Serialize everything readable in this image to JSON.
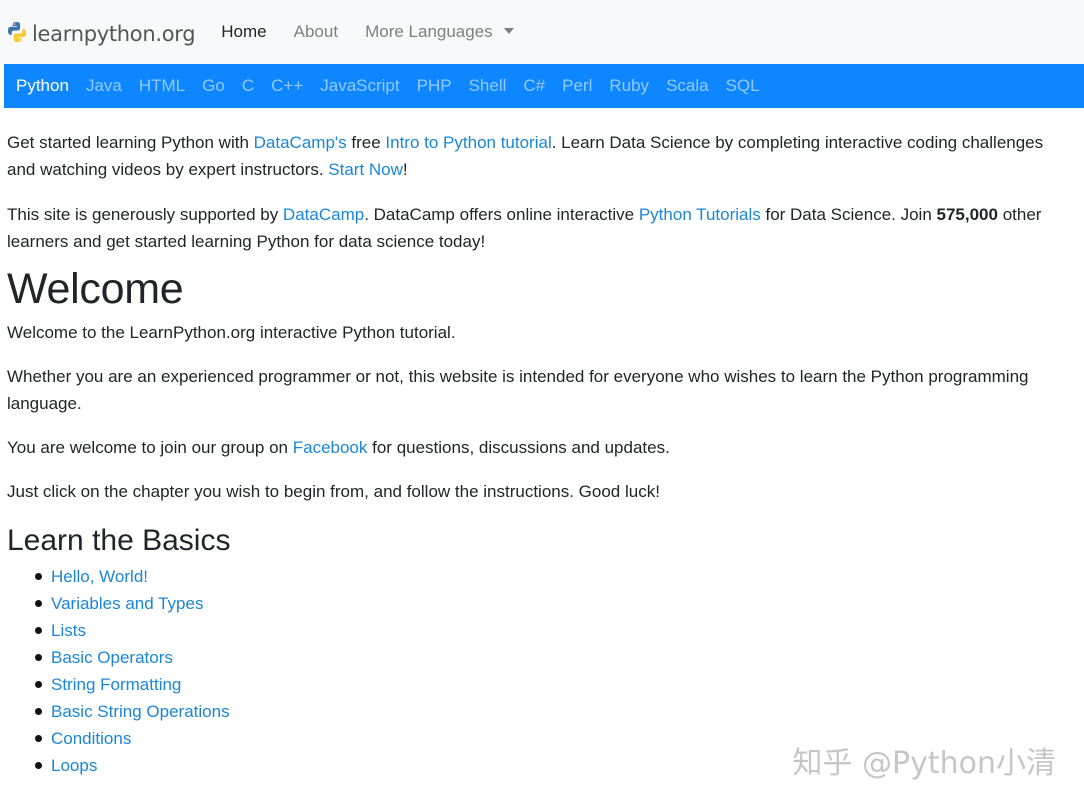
{
  "brand": {
    "name": "learnpython.org",
    "icon": "python-logo-icon"
  },
  "top_nav": {
    "home": "Home",
    "about": "About",
    "more_languages": "More Languages"
  },
  "languages": [
    "Python",
    "Java",
    "HTML",
    "Go",
    "C",
    "C++",
    "JavaScript",
    "PHP",
    "Shell",
    "C#",
    "Perl",
    "Ruby",
    "Scala",
    "SQL"
  ],
  "intro": {
    "p1_a": "Get started learning Python with ",
    "p1_link1": "DataCamp's",
    "p1_b": " free ",
    "p1_link2": "Intro to Python tutorial",
    "p1_c": ". Learn Data Science by completing interactive coding challenges and watching videos by expert instructors. ",
    "p1_link3": "Start Now",
    "p1_d": "!",
    "p2_a": "This site is generously supported by ",
    "p2_link1": "DataCamp",
    "p2_b": ". DataCamp offers online interactive ",
    "p2_link2": "Python Tutorials",
    "p2_c": " for Data Science. Join ",
    "p2_count": "575,000",
    "p2_d": " other learners and get started learning Python for data science today!"
  },
  "welcome": {
    "title": "Welcome",
    "p3": "Welcome to the LearnPython.org interactive Python tutorial.",
    "p4": "Whether you are an experienced programmer or not, this website is intended for everyone who wishes to learn the Python programming language.",
    "p5_a": "You are welcome to join our group on ",
    "p5_link": "Facebook",
    "p5_b": " for questions, discussions and updates.",
    "p6": "Just click on the chapter you wish to begin from, and follow the instructions. Good luck!"
  },
  "basics": {
    "title": "Learn the Basics",
    "items": [
      "Hello, World!",
      "Variables and Types",
      "Lists",
      "Basic Operators",
      "String Formatting",
      "Basic String Operations",
      "Conditions",
      "Loops"
    ]
  },
  "watermark": "知乎 @Python小清",
  "colors": {
    "accent": "#0d86ff",
    "link": "#1b86d8",
    "navbar_bg": "#f8f9fa"
  }
}
